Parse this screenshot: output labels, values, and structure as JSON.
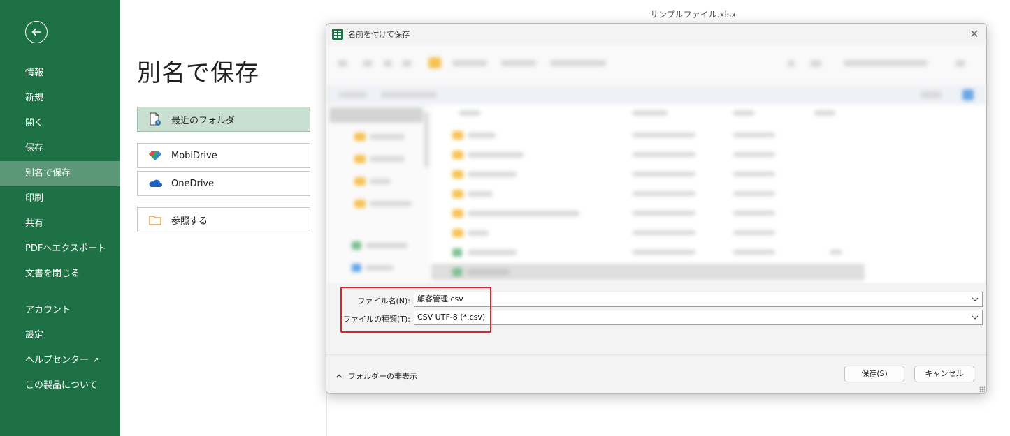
{
  "window": {
    "title": "サンプルファイル.xlsx"
  },
  "backstage": {
    "back_icon": "arrow-left-icon",
    "nav": [
      {
        "label": "情報",
        "active": false
      },
      {
        "label": "新規",
        "active": false
      },
      {
        "label": "開く",
        "active": false
      },
      {
        "label": "保存",
        "active": false
      },
      {
        "label": "別名で保存",
        "active": true
      },
      {
        "label": "印刷",
        "active": false
      },
      {
        "label": "共有",
        "active": false
      },
      {
        "label": "PDFヘエクスポート",
        "active": false
      },
      {
        "label": "文書を閉じる",
        "active": false
      },
      {
        "label": "アカウント",
        "active": false
      },
      {
        "label": "設定",
        "active": false
      },
      {
        "label": "ヘルプセンター",
        "active": false,
        "external": true
      },
      {
        "label": "この製品について",
        "active": false
      }
    ],
    "page_title": "別名で保存",
    "locations": [
      {
        "label": "最近のフォルダ",
        "icon": "recent-document-icon",
        "selected": true
      },
      {
        "label": "MobiDrive",
        "icon": "mobidrive-icon",
        "selected": false
      },
      {
        "label": "OneDrive",
        "icon": "onedrive-cloud-icon",
        "selected": false
      },
      {
        "label": "参照する",
        "icon": "folder-icon",
        "selected": false
      }
    ]
  },
  "dialog": {
    "title": "名前を付けて保存",
    "filename_label": "ファイル名(N):",
    "filename_value": "顧客管理.csv",
    "filetype_label": "ファイルの種類(T):",
    "filetype_value": "CSV UTF-8 (*.csv)",
    "hide_folders_label": "フォルダーの非表示",
    "save_button": "保存(S)",
    "cancel_button": "キャンセル"
  },
  "colors": {
    "sidebar_bg": "#1e7145",
    "highlight_border": "#d6252d",
    "selected_location": "#c9dfd2"
  }
}
